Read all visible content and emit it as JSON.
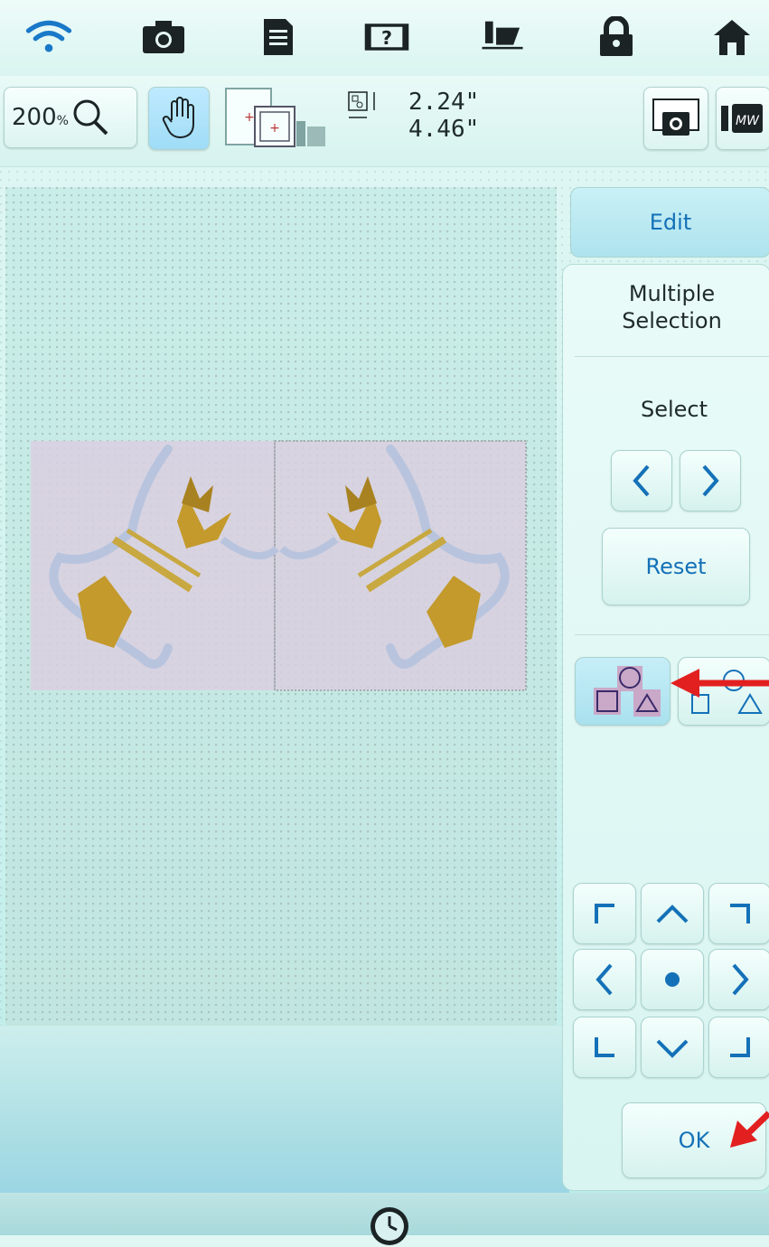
{
  "statusbar": {
    "icons": [
      "wifi-icon",
      "camera-icon",
      "document-icon",
      "help-icon",
      "sewing-machine-icon",
      "lock-icon",
      "home-icon"
    ]
  },
  "toolbar": {
    "zoom_value": "200",
    "zoom_unit": "%",
    "width_value": "2.24\"",
    "height_value": "4.46\""
  },
  "panel": {
    "edit_label": "Edit",
    "multiple_selection_line1": "Multiple",
    "multiple_selection_line2": "Selection",
    "select_label": "Select",
    "reset_label": "Reset",
    "ok_label": "OK"
  },
  "colors": {
    "accent_blue": "#1471b8",
    "annotation_red": "#e32020",
    "selection_fill": "#c9a8c8"
  }
}
